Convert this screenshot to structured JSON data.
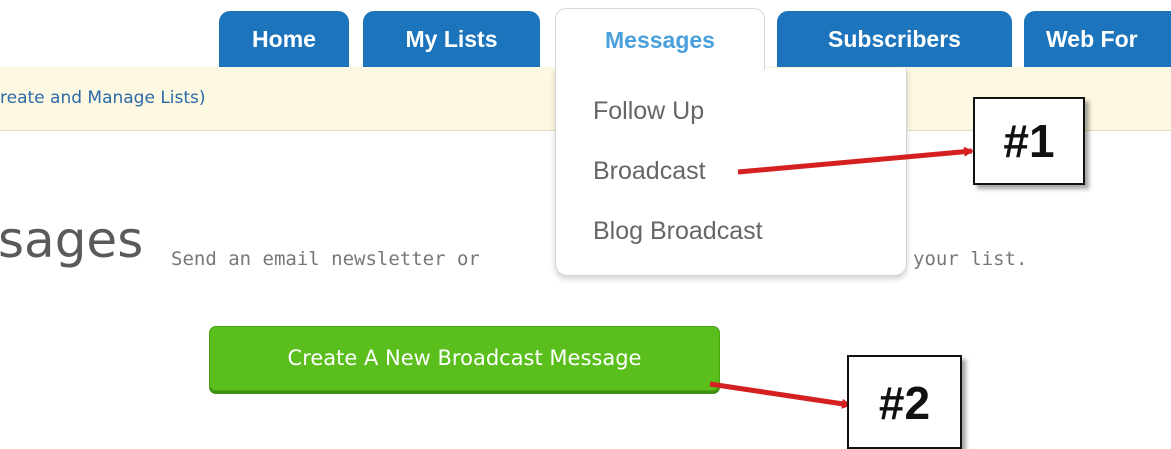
{
  "nav": {
    "tabs": [
      {
        "label": "Home"
      },
      {
        "label": "My Lists"
      },
      {
        "label": "Messages",
        "active": true
      },
      {
        "label": "Subscribers"
      },
      {
        "label": "Web For"
      }
    ],
    "dropdown": [
      "Follow Up",
      "Broadcast",
      "Blog Broadcast"
    ]
  },
  "notice": {
    "text": "reate and Manage Lists)"
  },
  "page": {
    "title": "sages",
    "description_left": "Send an email newsletter or",
    "description_right": "your list."
  },
  "actions": {
    "create_broadcast": "Create A New Broadcast Message"
  },
  "annotations": [
    "#1",
    "#2"
  ],
  "colors": {
    "tab_blue": "#1c75bc",
    "active_tab_text": "#4a9fdc",
    "button_green": "#5abf1d",
    "notice_bg": "#fdf8e1",
    "arrow_red": "#d42020"
  }
}
